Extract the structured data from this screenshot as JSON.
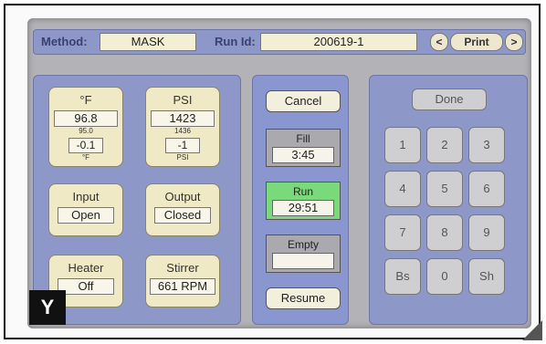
{
  "header": {
    "method_label": "Method:",
    "method_value": "MASK",
    "run_id_label": "Run Id:",
    "run_id_value": "200619-1",
    "prev_glyph": "<",
    "print_label": "Print",
    "next_glyph": ">"
  },
  "tiles": {
    "temp": {
      "title": "°F",
      "value": "96.8",
      "setpoint": "95.0",
      "delta": "-0.1",
      "footnote": "°F"
    },
    "psi": {
      "title": "PSI",
      "value": "1423",
      "setpoint": "1436",
      "delta": "-1",
      "footnote": "PSI"
    },
    "input": {
      "title": "Input",
      "value": "Open"
    },
    "output": {
      "title": "Output",
      "value": "Closed"
    },
    "heater": {
      "title": "Heater",
      "value": "Off"
    },
    "stirrer": {
      "title": "Stirrer",
      "value": "661 RPM"
    }
  },
  "controls": {
    "cancel_label": "Cancel",
    "fill_label": "Fill",
    "fill_value": "3:45",
    "run_label": "Run",
    "run_value": "29:51",
    "empty_label": "Empty",
    "empty_value": "",
    "resume_label": "Resume",
    "colors": {
      "fill": "#a9a9ae",
      "run": "#79d97b",
      "empty": "#a9a9ae"
    }
  },
  "keypad": {
    "done_label": "Done",
    "keys": [
      "1",
      "2",
      "3",
      "4",
      "5",
      "6",
      "7",
      "8",
      "9",
      "Bs",
      "0",
      "Sh"
    ]
  },
  "badge": "Y"
}
